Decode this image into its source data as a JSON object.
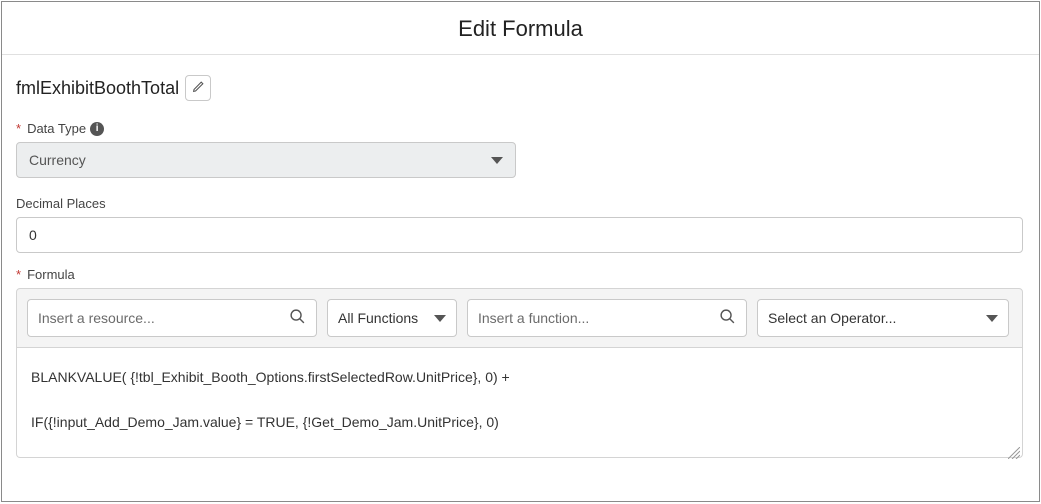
{
  "header": {
    "title": "Edit Formula"
  },
  "name": {
    "value": "fmlExhibitBoothTotal"
  },
  "dataType": {
    "label": "Data Type",
    "value": "Currency"
  },
  "decimalPlaces": {
    "label": "Decimal Places",
    "value": "0"
  },
  "formula": {
    "label": "Formula",
    "resource_placeholder": "Insert a resource...",
    "all_functions_label": "All Functions",
    "function_placeholder": "Insert a function...",
    "operator_placeholder": "Select an Operator...",
    "body": "BLANKVALUE( {!tbl_Exhibit_Booth_Options.firstSelectedRow.UnitPrice}, 0) +\n\nIF({!input_Add_Demo_Jam.value} = TRUE, {!Get_Demo_Jam.UnitPrice}, 0)"
  }
}
